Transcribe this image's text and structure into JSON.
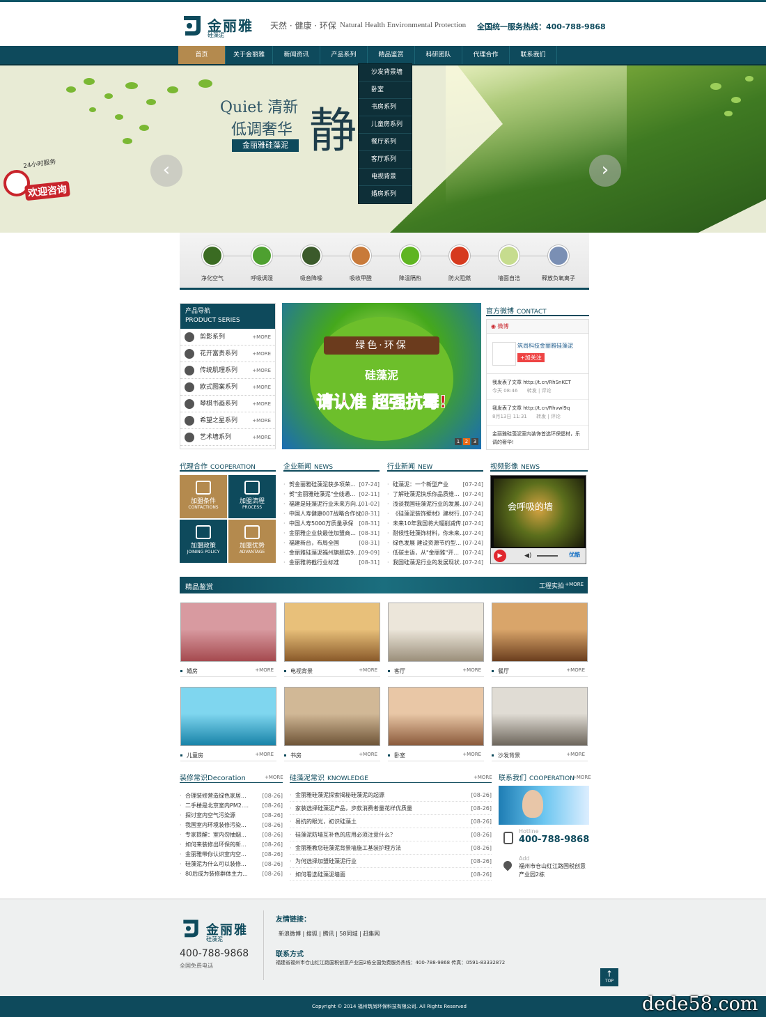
{
  "header": {
    "brand": "金丽雅",
    "brand_sub": "硅藻泥",
    "slogan_cn": "天然 · 健康 · 环保",
    "slogan_en": "Natural Health Environmental Protection",
    "hotline": "全国统一服务热线：400-788-9868"
  },
  "nav": [
    {
      "label": "首页",
      "active": true
    },
    {
      "label": "关于金丽雅"
    },
    {
      "label": "新闻资讯"
    },
    {
      "label": "产品系列"
    },
    {
      "label": "精品鉴赏"
    },
    {
      "label": "科研团队"
    },
    {
      "label": "代理合作"
    },
    {
      "label": "联系我们"
    }
  ],
  "dropdown": [
    "沙发背景墙",
    "卧室",
    "书房系列",
    "儿童房系列",
    "餐厅系列",
    "客厅系列",
    "电视背景",
    "婚房系列"
  ],
  "banner": {
    "line1": "Quiet 清新",
    "line2": "低调奢华",
    "big_char": "静",
    "pill": "金丽雅硅藻泥",
    "consult_top": "24小时服务",
    "consult": "欢迎咨询",
    "prev": "‹",
    "next": "›"
  },
  "features": [
    {
      "label": "净化空气",
      "color": "#3a6b22"
    },
    {
      "label": "呼吸调湿",
      "color": "#4ea030"
    },
    {
      "label": "吸音降噪",
      "color": "#3b5a2b"
    },
    {
      "label": "吸收甲醛",
      "color": "#c87a3a"
    },
    {
      "label": "降温隔热",
      "color": "#5fb521"
    },
    {
      "label": "防火阻燃",
      "color": "#d63a1e"
    },
    {
      "label": "墙面自洁",
      "color": "#c6dc8e"
    },
    {
      "label": "释放负氧离子",
      "color": "#7a8fb4"
    }
  ],
  "product_nav": {
    "title_cn": "产品导航",
    "title_en": "PRODUCT SERIES",
    "more": "+MORE",
    "items": [
      "剪影系列",
      "花开富贵系列",
      "传统肌理系列",
      "欧式图案系列",
      "琴棋书画系列",
      "希望之星系列",
      "艺术墙系列"
    ]
  },
  "promo": {
    "ribbon": "绿色·环保",
    "line1": "硅藻泥",
    "line2": "请认准 超强抗霉!",
    "pages": [
      "1",
      "2",
      "3"
    ]
  },
  "weibo": {
    "title_cn": "官方微博",
    "title_en": "CONTACT",
    "tab": "微博",
    "account": "筑尚科技金丽雅硅藻泥",
    "follow": "+加关注",
    "posts": [
      {
        "text": "我发表了文章 http://t.cn/RhSnKCT",
        "meta": "今天 08:46",
        "actions": "转发 | 评论"
      },
      {
        "text": "我发表了文章 http://t.cn/Rhvwl9q",
        "meta": "8月13日 11:31",
        "actions": "转发 | 评论"
      },
      {
        "text": "金丽雅硅藻泥室内装饰首选环保壁材，乐调的奢华!",
        "meta": "",
        "actions": ""
      }
    ]
  },
  "coop": {
    "title_cn": "代理合作",
    "title_en": "COOPERATION",
    "cells": [
      {
        "cn": "加盟条件",
        "en": "CONTACTIONS",
        "bg": "#b48a4e"
      },
      {
        "cn": "加盟流程",
        "en": "PROCESS",
        "bg": "#0e4a5c"
      },
      {
        "cn": "加盟政策",
        "en": "JOINING POLICY",
        "bg": "#0e4a5c"
      },
      {
        "cn": "加盟优势",
        "en": "ADVANTAGE",
        "bg": "#b48a4e"
      }
    ]
  },
  "company_news": {
    "title_cn": "企业新闻",
    "title_en": "NEWS",
    "items": [
      {
        "t": "贺金丽雅硅藻泥获多项荣...",
        "d": "[07-24]"
      },
      {
        "t": "贺\"金丽雅硅藻泥\"全线通...",
        "d": "[02-11]"
      },
      {
        "t": "福建是硅藻泥行业未来方向...",
        "d": "[01-02]"
      },
      {
        "t": "中国人寿健康007战略合作伙...",
        "d": "[08-31]"
      },
      {
        "t": "中国人寿5000万质量承保",
        "d": "[08-31]"
      },
      {
        "t": "金丽雅企业获最佳加盟商…",
        "d": "[08-31]"
      },
      {
        "t": "福建新台，布局全国",
        "d": "[08-31]"
      },
      {
        "t": "金丽雅硅藻泥福州旗舰店9...",
        "d": "[09-09]"
      },
      {
        "t": "金丽雅将截行业标准",
        "d": "[08-31]"
      }
    ]
  },
  "industry_news": {
    "title_cn": "行业新闻",
    "title_en": "NEW",
    "items": [
      {
        "t": "硅藻泥：一个新型产业",
        "d": "[07-24]"
      },
      {
        "t": "了解硅藻泥快乐你品质维...",
        "d": "[07-24]"
      },
      {
        "t": "浅谈我国硅藻泥行业的发展...",
        "d": "[07-24]"
      },
      {
        "t": "《硅藻泥装饰壁材》建材行...",
        "d": "[07-24]"
      },
      {
        "t": "未来10年我国将大幅削减传...",
        "d": "[07-24]"
      },
      {
        "t": "耐候性硅藻饰材料，你未来...",
        "d": "[07-24]"
      },
      {
        "t": "绿色发展 建设资源节约型...",
        "d": "[07-24]"
      },
      {
        "t": "低碳主语，从\"金丽雅\"开...",
        "d": "[07-24]"
      },
      {
        "t": "我国硅藻泥行业的发展现状...",
        "d": "[07-24]"
      }
    ]
  },
  "video": {
    "title_cn": "视频影像",
    "title_en": "NEWS",
    "caption": "会呼吸的墙",
    "player": "优酷"
  },
  "showcase": {
    "title": "精品鉴赏",
    "right": "工程实拍",
    "more": "+MORE",
    "items": [
      {
        "label": "婚房",
        "c1": "#d89aa0",
        "c2": "#a54a4f"
      },
      {
        "label": "电视背景",
        "c1": "#e8c07a",
        "c2": "#8a5a2a"
      },
      {
        "label": "客厅",
        "c1": "#ece6da",
        "c2": "#9b8f7b"
      },
      {
        "label": "餐厅",
        "c1": "#d9a56a",
        "c2": "#6b3e1e"
      },
      {
        "label": "儿童房",
        "c1": "#7fd6ef",
        "c2": "#1883a8"
      },
      {
        "label": "书房",
        "c1": "#d1b896",
        "c2": "#6e5437"
      },
      {
        "label": "卧室",
        "c1": "#e9c7a6",
        "c2": "#8b5a3b"
      },
      {
        "label": "沙发背景",
        "c1": "#e0dcd4",
        "c2": "#6d665c"
      }
    ]
  },
  "decoration": {
    "title_cn": "装修常识",
    "title_en": "Decoration",
    "more": "+MORE",
    "items": [
      {
        "t": "合理装修营造绿色家居...",
        "d": "[08-26]"
      },
      {
        "t": "二手楼是北京室内PM2....",
        "d": "[08-26]"
      },
      {
        "t": "探讨室内空气污染源",
        "d": "[08-26]"
      },
      {
        "t": "我国室内环境装修污染...",
        "d": "[08-26]"
      },
      {
        "t": "专家提醒：室内勿抽烟...",
        "d": "[08-26]"
      },
      {
        "t": "如何来装修出环保的新...",
        "d": "[08-26]"
      },
      {
        "t": "金丽雅带你认识室内空...",
        "d": "[08-26]"
      },
      {
        "t": "硅藻泥为什么可以装修...",
        "d": "[08-26]"
      },
      {
        "t": "80后成为装修群体主力...",
        "d": "[08-26]"
      }
    ]
  },
  "knowledge": {
    "title_cn": "硅藻泥常识",
    "title_en": "KNOWLEDGE",
    "more": "+MORE",
    "items": [
      {
        "t": "金丽雅硅藻泥探索揭秘硅藻泥的起源",
        "d": "[08-26]"
      },
      {
        "t": "家装选择硅藻泥产品，步款消费者量花样优质量",
        "d": "[08-26]"
      },
      {
        "t": "易抗的眼光，初识硅藻土",
        "d": "[08-26]"
      },
      {
        "t": "硅藻泥防墙互补色的应用必须注意什么？",
        "d": "[08-26]"
      },
      {
        "t": "金丽雅教您硅藻泥背景墙施工基装护理方法",
        "d": "[08-26]"
      },
      {
        "t": "为何选择加盟硅藻泥行业",
        "d": "[08-26]"
      },
      {
        "t": "如何看选硅藻泥墙面",
        "d": "[08-26]"
      }
    ]
  },
  "contact": {
    "title_cn": "联系我们",
    "title_en": "COOPERATION",
    "more": "+MORE",
    "hotline_label": "Hotline",
    "hotline": "400-788-9868",
    "add_label": "Add",
    "address": "福州市仓山红江路国税创意产业园2栋"
  },
  "footer": {
    "brand": "金丽雅",
    "brand_sub": "硅藻泥",
    "phone": "400-788-9868",
    "phone_label": "全国免费电话",
    "links_title": "友情链接：",
    "links": [
      "新浪微博",
      "搜狐",
      "腾讯",
      "58同城",
      "赶集网"
    ],
    "contact_title": "联系方式",
    "contact_text": "福建省福州市仓山红江路国税创意产业园2栋全国免费服务热线：400-788-9868 传真：0591-83332872",
    "copyright": "Copyright © 2014 福州筑尚环保科技有限公司. All Rights Reserved",
    "top": "TOP",
    "watermark": "dede58.com"
  }
}
